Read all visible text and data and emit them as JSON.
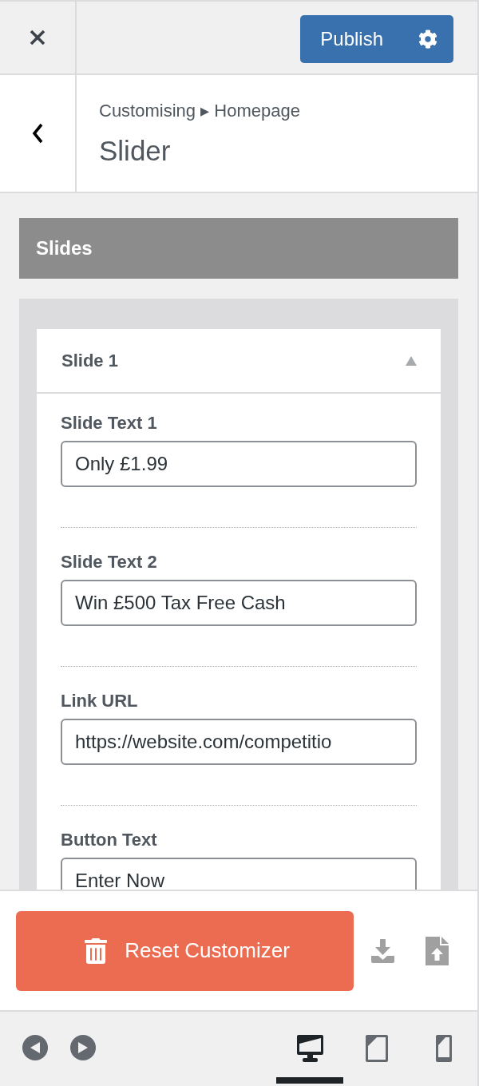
{
  "header": {
    "publish": {
      "label": "Publish"
    }
  },
  "section": {
    "breadcrumb": "Customising ▸ Homepage",
    "title": "Slider"
  },
  "panel": {
    "title": "Slides"
  },
  "slides": [
    {
      "title": "Slide 1",
      "expanded": true,
      "fields": [
        {
          "label": "Slide Text 1",
          "value": "Only £1.99"
        },
        {
          "label": "Slide Text 2",
          "value": "Win £500 Tax Free Cash"
        },
        {
          "label": "Link URL",
          "value": "https://website.com/competitio"
        },
        {
          "label": "Button Text",
          "value": "Enter Now"
        }
      ]
    }
  ],
  "footer": {
    "reset": {
      "label": "Reset Customizer"
    }
  },
  "devices": [
    {
      "kind": "desktop",
      "selected": true
    },
    {
      "kind": "tablet",
      "selected": false
    },
    {
      "kind": "mobile",
      "selected": false
    }
  ]
}
